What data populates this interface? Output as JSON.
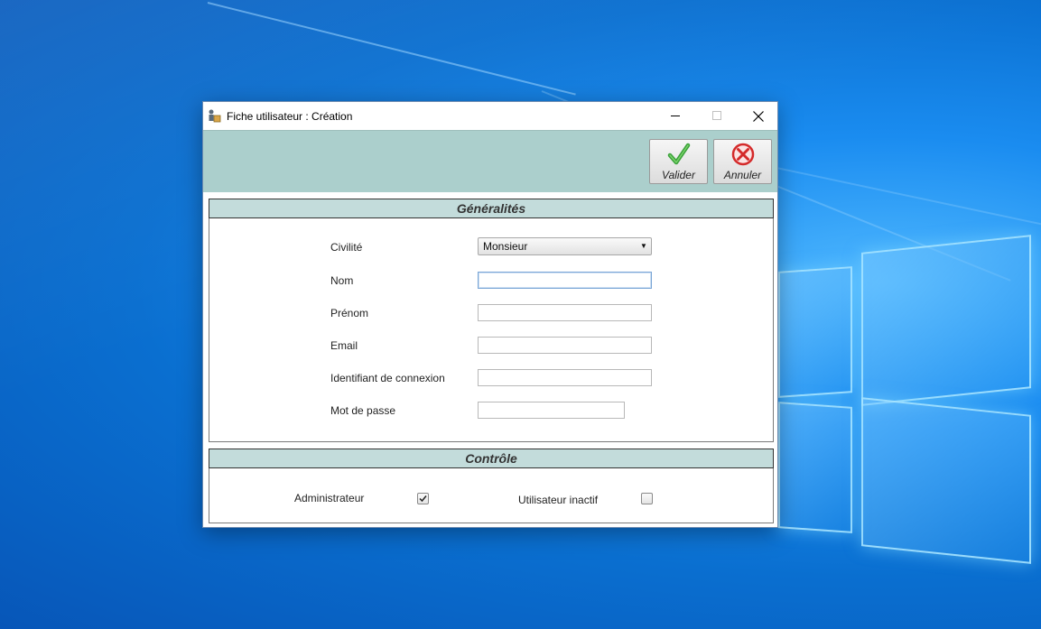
{
  "window": {
    "title": "Fiche utilisateur : Création",
    "controls": {
      "minimize": "—",
      "maximize": "☐",
      "close": "✕"
    }
  },
  "toolbar": {
    "valider_label": "Valider",
    "annuler_label": "Annuler",
    "valider_icon": "green-checkmark-icon",
    "annuler_icon": "red-cancel-icon"
  },
  "sections": {
    "generalites": {
      "title": "Généralités",
      "civilite_label": "Civilité",
      "civilite_value": "Monsieur",
      "nom_label": "Nom",
      "nom_value": "",
      "prenom_label": "Prénom",
      "prenom_value": "",
      "email_label": "Email",
      "email_value": "",
      "identifiant_label": "Identifiant de connexion",
      "identifiant_value": "",
      "motdepasse_label": "Mot de passe",
      "motdepasse_value": ""
    },
    "controle": {
      "title": "Contrôle",
      "administrateur_label": "Administrateur",
      "administrateur_checked": true,
      "inactif_label": "Utilisateur inactif",
      "inactif_checked": false
    }
  },
  "colors": {
    "toolbar_bg": "#abcfcc",
    "section_header_bg": "#c3dcdb",
    "desktop_bg": "#0a74d6"
  }
}
